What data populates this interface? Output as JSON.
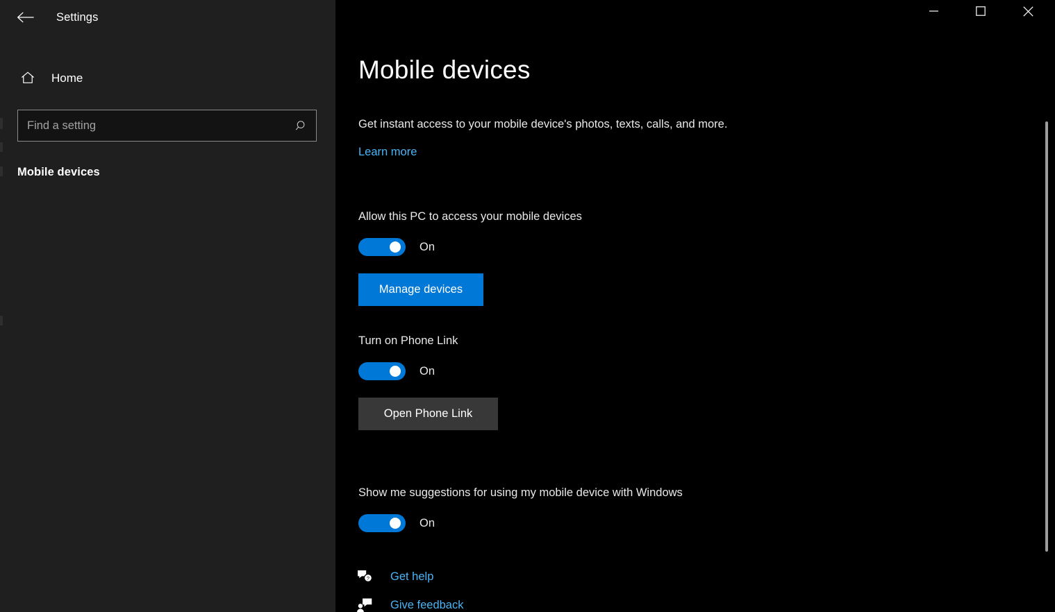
{
  "window": {
    "title": "Settings",
    "back_icon": "back-arrow-icon",
    "minimize_icon": "minimize-icon",
    "maximize_icon": "maximize-icon",
    "close_icon": "close-icon"
  },
  "sidebar": {
    "home": {
      "label": "Home",
      "icon": "home-icon"
    },
    "search": {
      "placeholder": "Find a setting",
      "value": "",
      "icon": "search-icon"
    },
    "section_title": "Mobile devices"
  },
  "main": {
    "title": "Mobile devices",
    "description": "Get instant access to your mobile device's photos, texts, calls, and more.",
    "learn_more": "Learn more",
    "settings": [
      {
        "label": "Allow this PC to access your mobile devices",
        "toggle_state": "On",
        "toggle_on": true,
        "button": {
          "label": "Manage devices",
          "style": "primary"
        }
      },
      {
        "label": "Turn on Phone Link",
        "toggle_state": "On",
        "toggle_on": true,
        "button": {
          "label": "Open Phone Link",
          "style": "secondary"
        }
      },
      {
        "label": "Show me suggestions for using my mobile device with Windows",
        "toggle_state": "On",
        "toggle_on": true
      }
    ],
    "footer_links": [
      {
        "label": "Get help",
        "icon": "help-question-bubble-icon"
      },
      {
        "label": "Give feedback",
        "icon": "feedback-person-bubble-icon"
      }
    ]
  },
  "colors": {
    "accent": "#0078d7",
    "link": "#4cb3f5",
    "sidebar_bg": "#1f1f1f",
    "content_bg": "#000000",
    "secondary_button": "#383838"
  },
  "scrollbar": {
    "visible": true
  }
}
